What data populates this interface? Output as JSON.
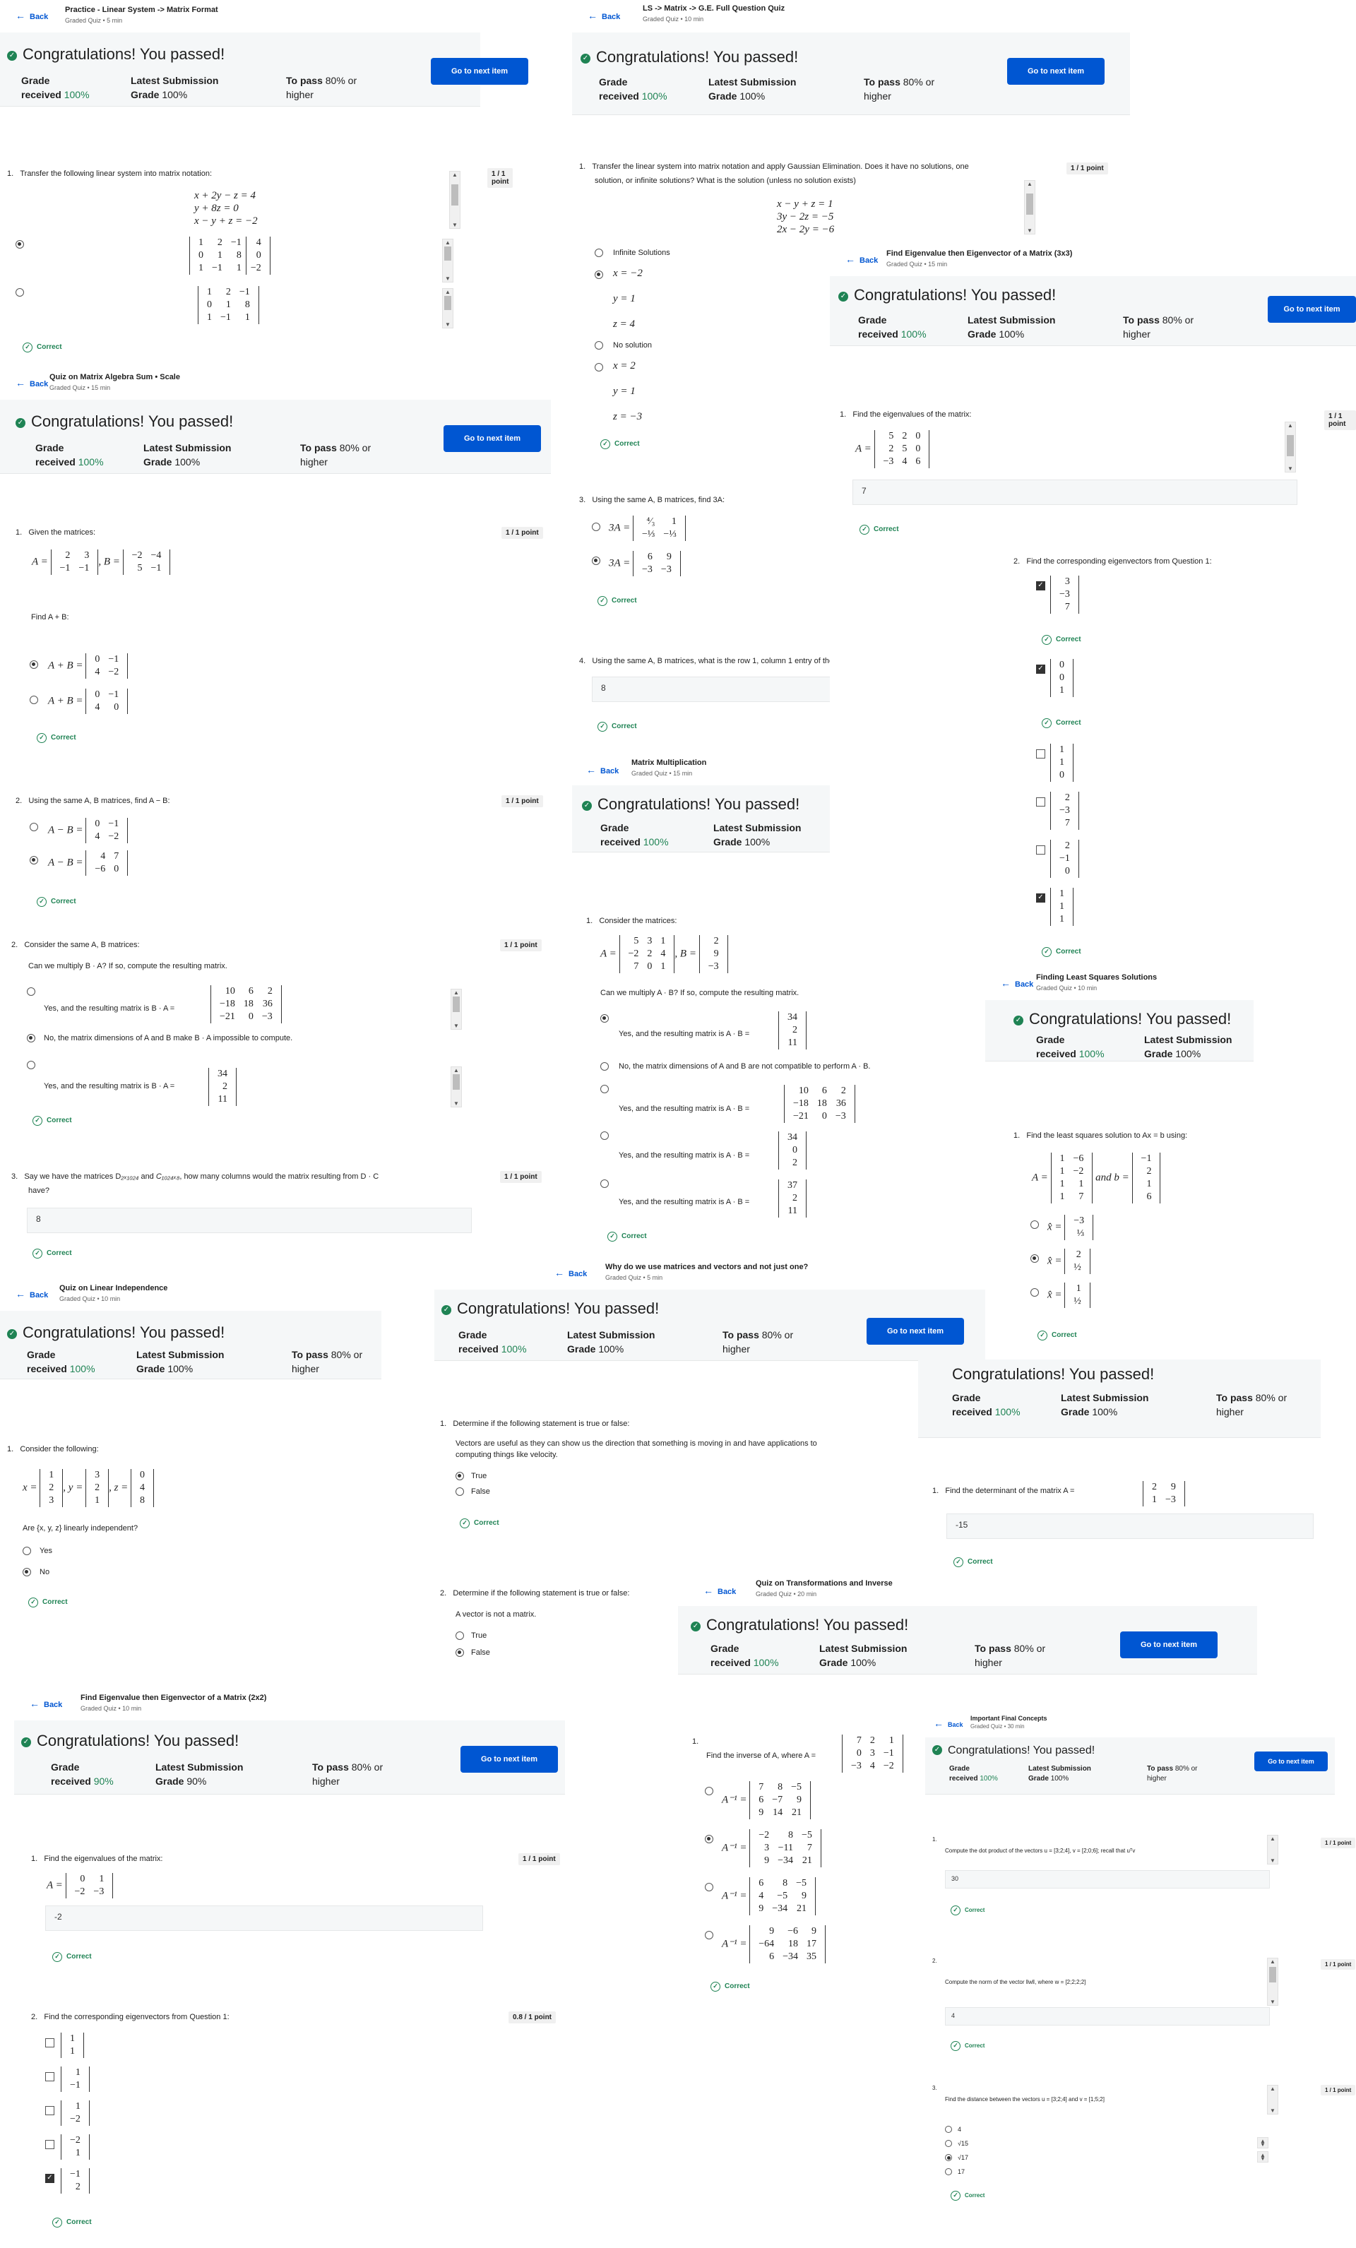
{
  "common": {
    "back": "Back",
    "congrats": "Congratulations! You passed!",
    "grade": "Grade",
    "received": "received",
    "latest": "Latest Submission",
    "gradeword": "Grade",
    "topass": "To pass",
    "pass_pct": "80% or",
    "higher": "higher",
    "next": "Go to next item",
    "correct": "Correct",
    "point": "1 / 1 point"
  },
  "panels": [
    {
      "title": "Practice - Linear System -> Matrix Format",
      "sub": "Graded Quiz • 5 min",
      "received": "100%",
      "latest": "100%",
      "q1": "Transfer the following linear system into matrix notation:"
    },
    {
      "title": "LS -> Matrix -> G.E. Full Question Quiz",
      "sub": "Graded Quiz • 10 min",
      "received": "100%",
      "latest": "100%",
      "q1": "Transfer the linear system into matrix notation and apply Gaussian Elimination. Does it have no solutions, one",
      "q1b": "solution, or infinite solutions? What is the solution (unless no solution exists)",
      "opt_inf": "Infinite Solutions",
      "opt_no": "No solution"
    },
    {
      "title": "Find Eigenvalue then Eigenvector of a Matrix (3x3)",
      "sub": "Graded Quiz • 15 min",
      "received": "100%",
      "latest": "100%",
      "q1": "Find the eigenvalues of the matrix:",
      "a1": "7",
      "q2": "Find the corresponding eigenvectors from Question 1:"
    },
    {
      "title": "Quiz on Matrix Algebra Sum • Scale",
      "sub": "Graded Quiz • 15 min",
      "received": "100%",
      "latest": "100%",
      "q1": "Given the matrices:",
      "q1b": "Find A + B:",
      "q2": "Using the same A, B matrices, find A − B:",
      "q3": "Consider the same A, B matrices:",
      "q3b": "Can we multiply B · A? If so, compute the resulting matrix.",
      "q3o1": "Yes, and the resulting matrix is B · A =",
      "q3o2": "No, the matrix dimensions of A and B make B · A impossible to compute.",
      "q3o3": "Yes, and the resulting matrix is B · A =",
      "q4": "Say we have the matrices D",
      "q4b": "how many columns would the matrix resulting from D · C",
      "q4c": "have?",
      "a4": "8"
    },
    {
      "title": "Matrix Multiplication",
      "sub": "Graded Quiz • 15 min",
      "received": "100%",
      "latest": "100%",
      "q3": "Using the same A, B matrices, find 3A:",
      "q4": "Using the same A, B matrices, what is the row 1, column 1 entry of the matrix resulting from 3A − B?",
      "a4": "8",
      "q1": "Consider the matrices:",
      "q1b": "Can we multiply A · B? If so, compute the resulting matrix.",
      "o1": "Yes, and the resulting matrix is A · B =",
      "o2": "No, the matrix dimensions of A and B are not compatible to perform A · B.",
      "o3": "Yes, and the resulting matrix is A · B ="
    },
    {
      "title": "Finding Least Squares Solutions",
      "sub": "Graded Quiz • 10 min",
      "received": "100%",
      "latest": "100%",
      "q1": "Find the least squares solution to Ax = b using:"
    },
    {
      "title": "Quiz on Linear Independence",
      "sub": "Graded Quiz • 10 min",
      "received": "100%",
      "latest": "100%",
      "q1": "Consider the following:",
      "q1b": "Are {x, y, z} linearly independent?",
      "yes": "Yes",
      "no": "No"
    },
    {
      "title": "Why do we use matrices and vectors and not just one?",
      "sub": "Graded Quiz • 5 min",
      "received": "100%",
      "latest": "100%",
      "q1": "Determine if the following statement is true or false:",
      "q1b": "Vectors are useful as they can show us the direction that something is moving in and have applications to",
      "q1c": "computing things like velocity.",
      "t": "True",
      "f": "False",
      "q2": "Determine if the following statement is true or false:",
      "q2b": "A vector is not a matrix."
    },
    {
      "title": "",
      "sub": "",
      "received": "100%",
      "latest": "100%",
      "q1": "Find the determinant of the matrix A =",
      "a1": "-15"
    },
    {
      "title": "Quiz on Transformations and Inverse",
      "sub": "Graded Quiz • 20 min",
      "received": "100%",
      "latest": "100%",
      "q1": "Find the inverse of A, where A ="
    },
    {
      "title": "Find Eigenvalue then Eigenvector of a Matrix (2x2)",
      "sub": "Graded Quiz • 10 min",
      "received": "90%",
      "latest": "90%",
      "q1": "Find the eigenvalues of the matrix:",
      "a1": "-2",
      "q2": "Find the corresponding eigenvectors from Question 1:",
      "pts2": "0.8 / 1 point"
    },
    {
      "title": "Important Final Concepts",
      "sub": "Graded Quiz • 30 min",
      "received": "100%",
      "latest": "100%",
      "q1": "Compute the dot product of the vectors u =",
      "q1b": "recall that",
      "a1": "30",
      "q2": "Compute the norm of the vector",
      "a2": "4",
      "q3": "Find the distance between the vectors u =",
      "o1": "4",
      "o2": "√15",
      "o3": "√17",
      "o4": "17"
    }
  ]
}
